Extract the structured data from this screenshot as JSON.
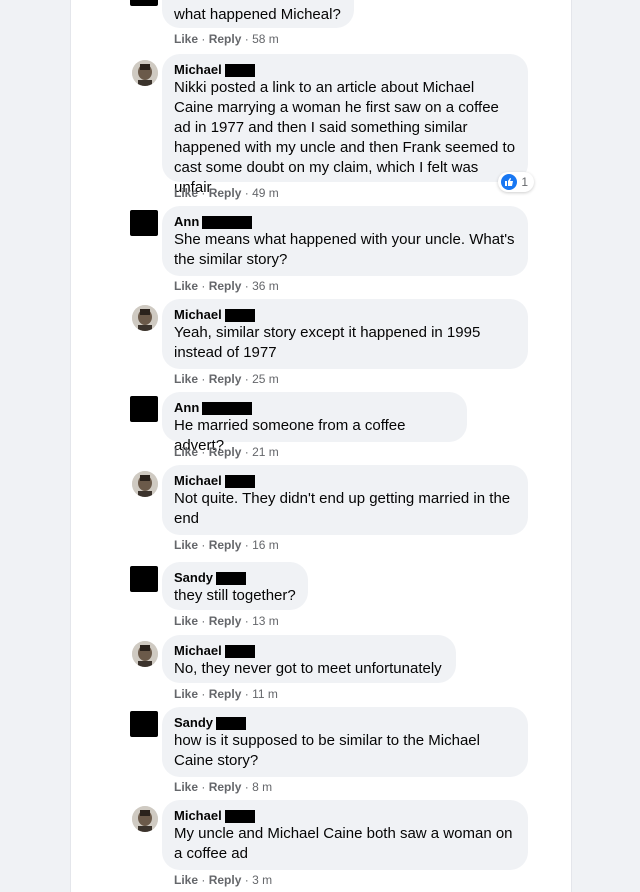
{
  "meta": {
    "like": "Like",
    "reply": "Reply",
    "sep": "·"
  },
  "comments": [
    {
      "author": "",
      "text": "what happened Micheal?",
      "time": "58 m"
    },
    {
      "author": "Michael",
      "text": "Nikki posted a link to an article about Michael Caine marrying a woman he first saw on a coffee ad in 1977 and then I said something similar happened with my uncle and then Frank seemed to cast some doubt on my claim, which I felt was unfair",
      "time": "49 m",
      "reaction_count": "1"
    },
    {
      "author": "Ann",
      "text": "She means what happened with your uncle. What's the similar story?",
      "time": "36 m"
    },
    {
      "author": "Michael",
      "text": "Yeah, similar story except it happened in 1995 instead of 1977",
      "time": "25 m"
    },
    {
      "author": "Ann",
      "text": "He married someone from a coffee advert?",
      "time": "21 m"
    },
    {
      "author": "Michael",
      "text": "Not quite. They didn't end up getting married in the end",
      "time": "16 m"
    },
    {
      "author": "Sandy",
      "text": "they still together?",
      "time": "13 m"
    },
    {
      "author": "Michael",
      "text": "No, they never got to meet unfortunately",
      "time": "11 m"
    },
    {
      "author": "Sandy",
      "text": "how is it supposed to be similar to the Michael Caine story?",
      "time": "8 m"
    },
    {
      "author": "Michael",
      "text": "My uncle and Michael Caine both saw a woman on a coffee ad",
      "time": "3 m"
    }
  ]
}
